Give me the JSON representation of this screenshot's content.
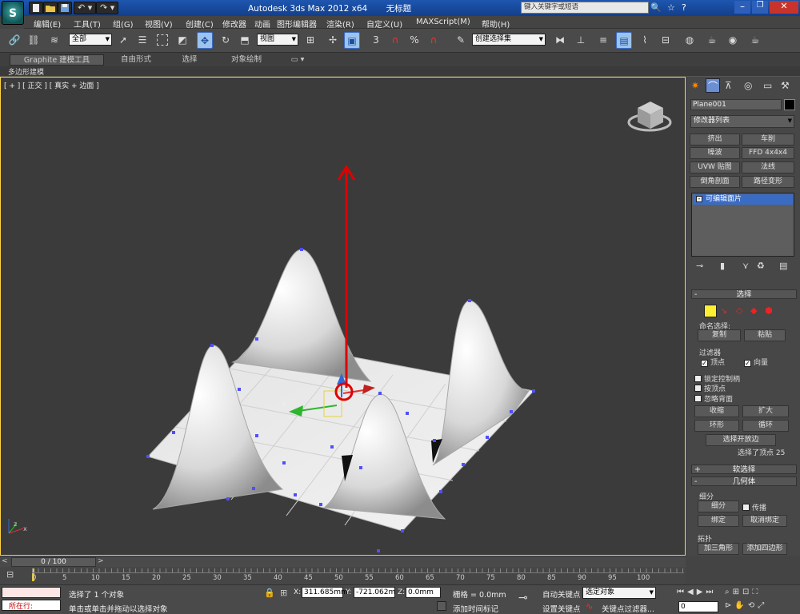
{
  "window": {
    "title": "Autodesk 3ds Max  2012 x64",
    "doc_title": "无标题",
    "search_placeholder": "键入关键字或短语"
  },
  "menu": [
    "编辑(E)",
    "工具(T)",
    "组(G)",
    "视图(V)",
    "创建(C)",
    "修改器",
    "动画",
    "图形编辑器",
    "渲染(R)",
    "自定义(U)",
    "MAXScript(M)",
    "帮助(H)"
  ],
  "toolbar": {
    "selection_filter": "全部",
    "ref_coord": "视图",
    "named_selection_placeholder": "创建选择集",
    "snap_label": "3"
  },
  "ribbon": {
    "tabs": [
      "Graphite 建模工具",
      "自由形式",
      "选择",
      "对象绘制"
    ],
    "sub_label": "多边形建模"
  },
  "viewport": {
    "label": "[ + ] [ 正交 ] [ 真实 + 边面 ]",
    "axis_labels": {
      "x": "x",
      "y": "y",
      "z": "z"
    }
  },
  "command_panel": {
    "object_name": "Plane001",
    "modifier_list": "修改器列表",
    "modifier_buttons": [
      [
        "挤出",
        "车削"
      ],
      [
        "噪波",
        "FFD 4x4x4"
      ],
      [
        "UVW 贴图",
        "法线"
      ],
      [
        "倒角剖面",
        "路径变形"
      ]
    ],
    "stack_item": "可编辑面片",
    "selection": {
      "header": "选择",
      "named_sel": "命名选择:",
      "copy": "复制",
      "paste": "粘贴",
      "filter": "过滤器",
      "vertex": "顶点",
      "vector": "向量",
      "lock_handles": "锁定控制柄",
      "by_vertex": "按顶点",
      "ignore_backfacing": "忽略背面",
      "shrink": "收缩",
      "grow": "扩大",
      "ring": "环形",
      "loop": "循环",
      "select_open_edges": "选择开放边",
      "selected_count": "选择了顶点 25"
    },
    "soft_selection": "软选择",
    "geometry": {
      "header": "几何体",
      "subdivide_group": "细分",
      "subdivide": "细分",
      "propagate": "传播",
      "bind": "绑定",
      "unbind": "取消绑定",
      "topology": "拓扑",
      "add_tri": "加三角形",
      "add_quad": "添加四边形"
    }
  },
  "timeline": {
    "frame": "0 / 100",
    "ticks": [
      "0",
      "5",
      "10",
      "15",
      "20",
      "25",
      "30",
      "35",
      "40",
      "45",
      "50",
      "55",
      "60",
      "65",
      "70",
      "75",
      "80",
      "85",
      "90",
      "95",
      "100"
    ]
  },
  "status": {
    "running": "所在行:",
    "selected": "选择了 1 个对象",
    "prompt": "单击或单击并拖动以选择对象",
    "x_label": "X:",
    "x": "311.685mm",
    "y_label": "Y:",
    "y": "-721.062m",
    "z_label": "Z:",
    "z": "0.0mm",
    "grid": "栅格 = 0.0mm",
    "add_time_tag": "添加时间标记",
    "auto_key": "自动关键点",
    "set_key": "设置关键点",
    "selected_obj": "选定对象",
    "key_filters": "关键点过滤器...",
    "frame_field": "0"
  },
  "colors": {
    "accent": "#ffd23f",
    "gizmo": "#e00000",
    "selected_stack": "#3b6cc4"
  }
}
